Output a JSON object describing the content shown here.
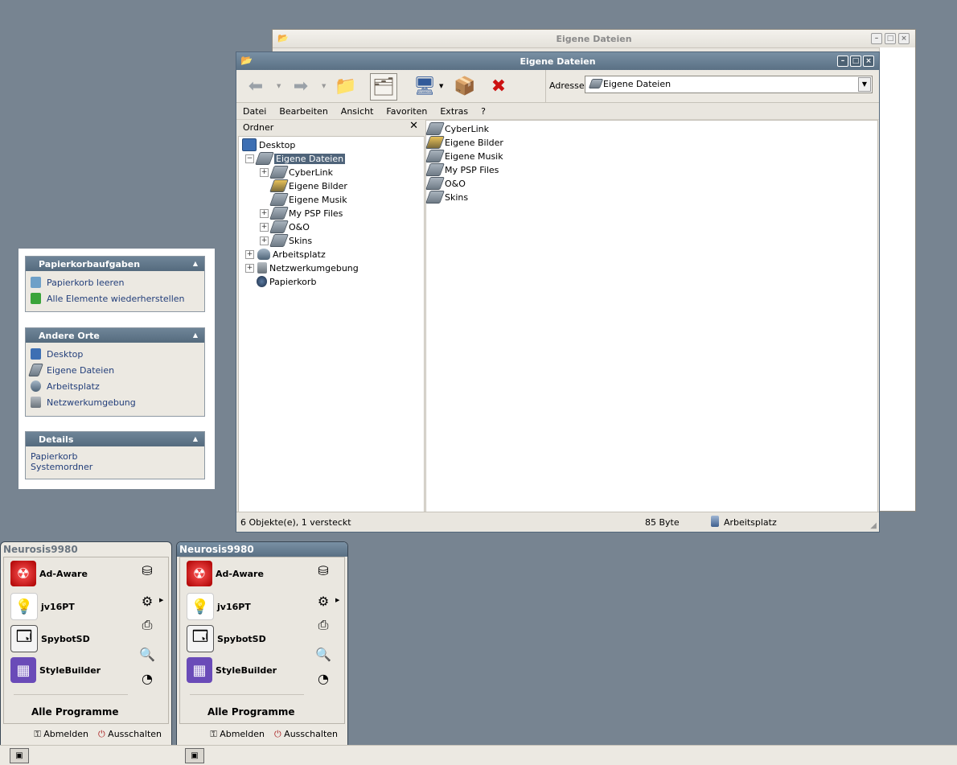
{
  "back_window": {
    "title": "Eigene Dateien"
  },
  "main_window": {
    "title": "Eigene Dateien",
    "address_label": "Adresse",
    "address_value": "Eigene Dateien",
    "menu": [
      "Datei",
      "Bearbeiten",
      "Ansicht",
      "Favoriten",
      "Extras",
      "?"
    ],
    "folder_pane_title": "Ordner",
    "tree": [
      {
        "label": "Desktop",
        "expander": ""
      },
      {
        "label": "Eigene Dateien",
        "expander": "−"
      },
      {
        "label": "CyberLink",
        "expander": "+"
      },
      {
        "label": "Eigene Bilder",
        "expander": ""
      },
      {
        "label": "Eigene Musik",
        "expander": ""
      },
      {
        "label": "My PSP Files",
        "expander": "+"
      },
      {
        "label": "O&O",
        "expander": "+"
      },
      {
        "label": "Skins",
        "expander": "+"
      },
      {
        "label": "Arbeitsplatz",
        "expander": "+"
      },
      {
        "label": "Netzwerkumgebung",
        "expander": "+"
      },
      {
        "label": "Papierkorb",
        "expander": ""
      }
    ],
    "files": [
      "CyberLink",
      "Eigene Bilder",
      "Eigene Musik",
      "My PSP Files",
      "O&O",
      "Skins"
    ],
    "status": {
      "objects": "6 Objekte(e), 1 versteckt",
      "size": "85 Byte",
      "location": "Arbeitsplatz"
    }
  },
  "tasks": {
    "sections": [
      {
        "title": "Papierkorbaufgaben",
        "items": [
          "Papierkorb leeren",
          "Alle Elemente wiederherstellen"
        ]
      },
      {
        "title": "Andere Orte",
        "items": [
          "Desktop",
          "Eigene Dateien",
          "Arbeitsplatz",
          "Netzwerkumgebung"
        ]
      },
      {
        "title": "Details",
        "items": [
          "Papierkorb",
          "Systemordner"
        ]
      }
    ]
  },
  "start_menus": [
    {
      "user": "Neurosis9980",
      "programs": [
        "Ad-Aware",
        "jv16PT",
        "SpybotSD",
        "StyleBuilder"
      ],
      "all_programs": "Alle Programme",
      "logoff": "Abmelden",
      "shutdown": "Ausschalten"
    },
    {
      "user": "Neurosis9980",
      "programs": [
        "Ad-Aware",
        "jv16PT",
        "SpybotSD",
        "StyleBuilder"
      ],
      "all_programs": "Alle Programme",
      "logoff": "Abmelden",
      "shutdown": "Ausschalten"
    }
  ],
  "colors": {
    "desktop": "#778491",
    "titlebar": "#5a7084",
    "selection": "#4f647a"
  }
}
